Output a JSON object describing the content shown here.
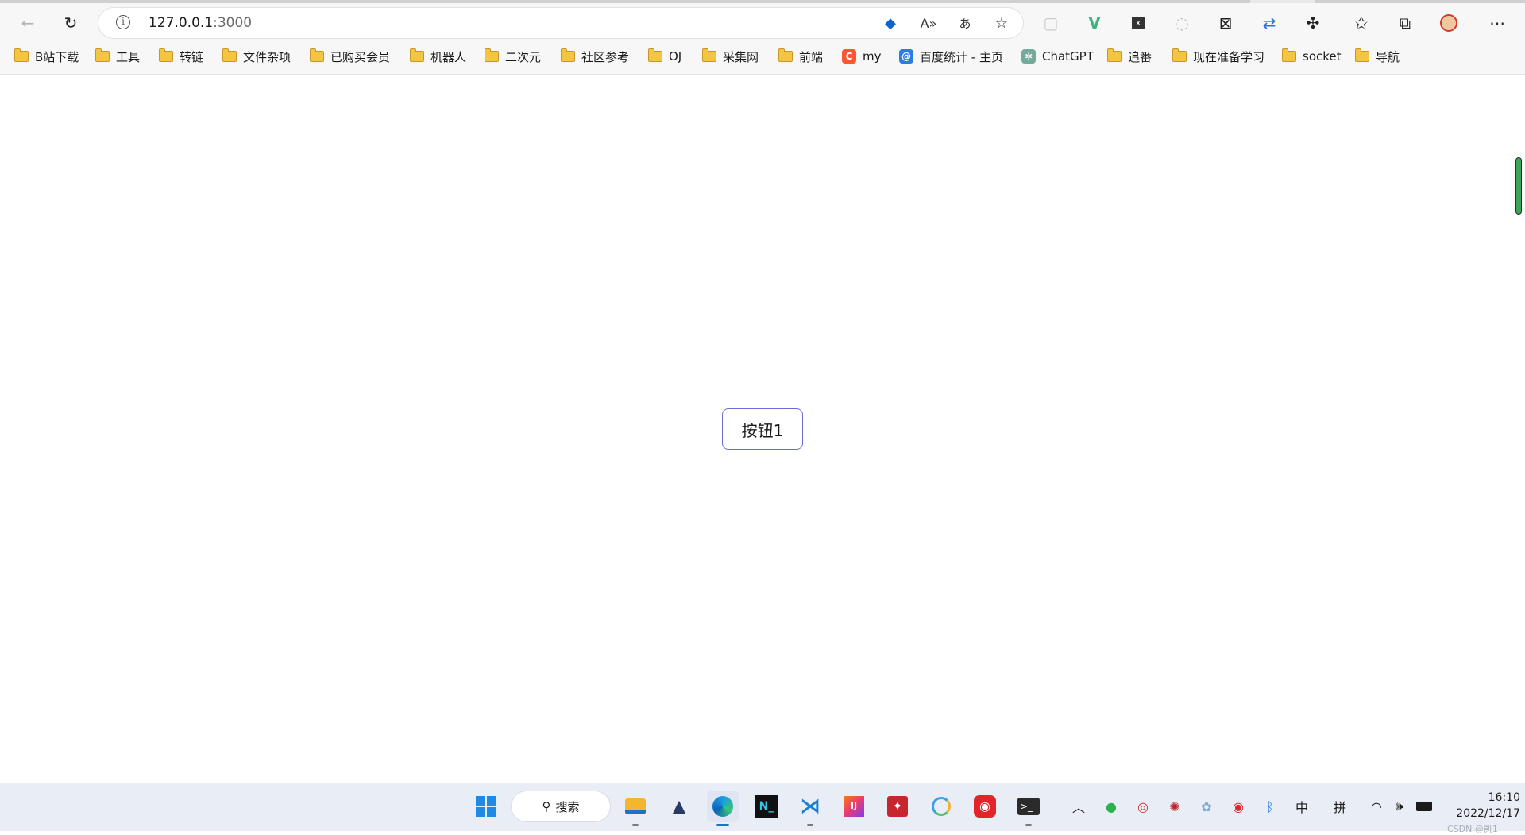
{
  "browser": {
    "address": {
      "host": "127.0.0.1",
      "port": ":3000"
    },
    "bookmarks": [
      {
        "label": "B站下载",
        "icon": "folder-icon"
      },
      {
        "label": "工具",
        "icon": "folder-icon"
      },
      {
        "label": "转链",
        "icon": "folder-icon"
      },
      {
        "label": "文件杂项",
        "icon": "folder-icon"
      },
      {
        "label": "已购买会员",
        "icon": "folder-icon"
      },
      {
        "label": "机器人",
        "icon": "folder-icon"
      },
      {
        "label": "二次元",
        "icon": "folder-icon"
      },
      {
        "label": "社区参考",
        "icon": "folder-icon"
      },
      {
        "label": "OJ",
        "icon": "folder-icon"
      },
      {
        "label": "采集网",
        "icon": "folder-icon"
      },
      {
        "label": "前端",
        "icon": "folder-icon"
      },
      {
        "label": "my",
        "icon": "csdn-favicon",
        "glyph": "C",
        "color": "#fc5531"
      },
      {
        "label": "百度统计 - 主页",
        "icon": "baidu-tongji-favicon",
        "glyph": "@",
        "color": "#2f7be6"
      },
      {
        "label": "ChatGPT",
        "icon": "chatgpt-favicon",
        "glyph": "✲",
        "color": "#74aa9c"
      },
      {
        "label": "追番",
        "icon": "folder-icon"
      },
      {
        "label": "现在准备学习",
        "icon": "folder-icon"
      },
      {
        "label": "socket",
        "icon": "folder-icon"
      },
      {
        "label": "导航",
        "icon": "folder-icon"
      }
    ]
  },
  "page": {
    "button1_label": "按钮1"
  },
  "taskbar": {
    "search_label": "搜索",
    "ime_lang": "中",
    "ime_mode": "拼",
    "time": "16:10",
    "date": "2022/12/17"
  },
  "watermark": "CSDN @凯1"
}
